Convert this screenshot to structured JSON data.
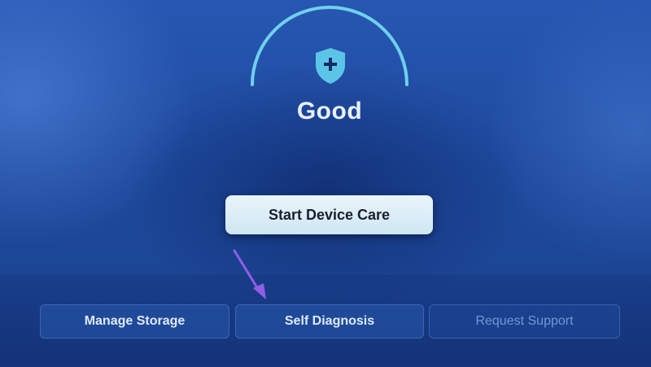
{
  "device_care": {
    "status": "Good",
    "start_button_label": "Start Device Care"
  },
  "bottom_menu": {
    "items": [
      {
        "label": "Manage Storage",
        "state": "enabled"
      },
      {
        "label": "Self Diagnosis",
        "state": "enabled"
      },
      {
        "label": "Request Support",
        "state": "disabled"
      }
    ]
  },
  "icons": {
    "status_icon": "shield-plus-icon",
    "annotation": "pointer-arrow-icon"
  },
  "colors": {
    "background": "#1e4a9e",
    "gauge_arc": "#6fd0ee",
    "shield": "#5cc4e6",
    "primary_button": "#dcedf7",
    "annotation_arrow": "#8f5fe6",
    "disabled_text": "#6f98d6"
  }
}
